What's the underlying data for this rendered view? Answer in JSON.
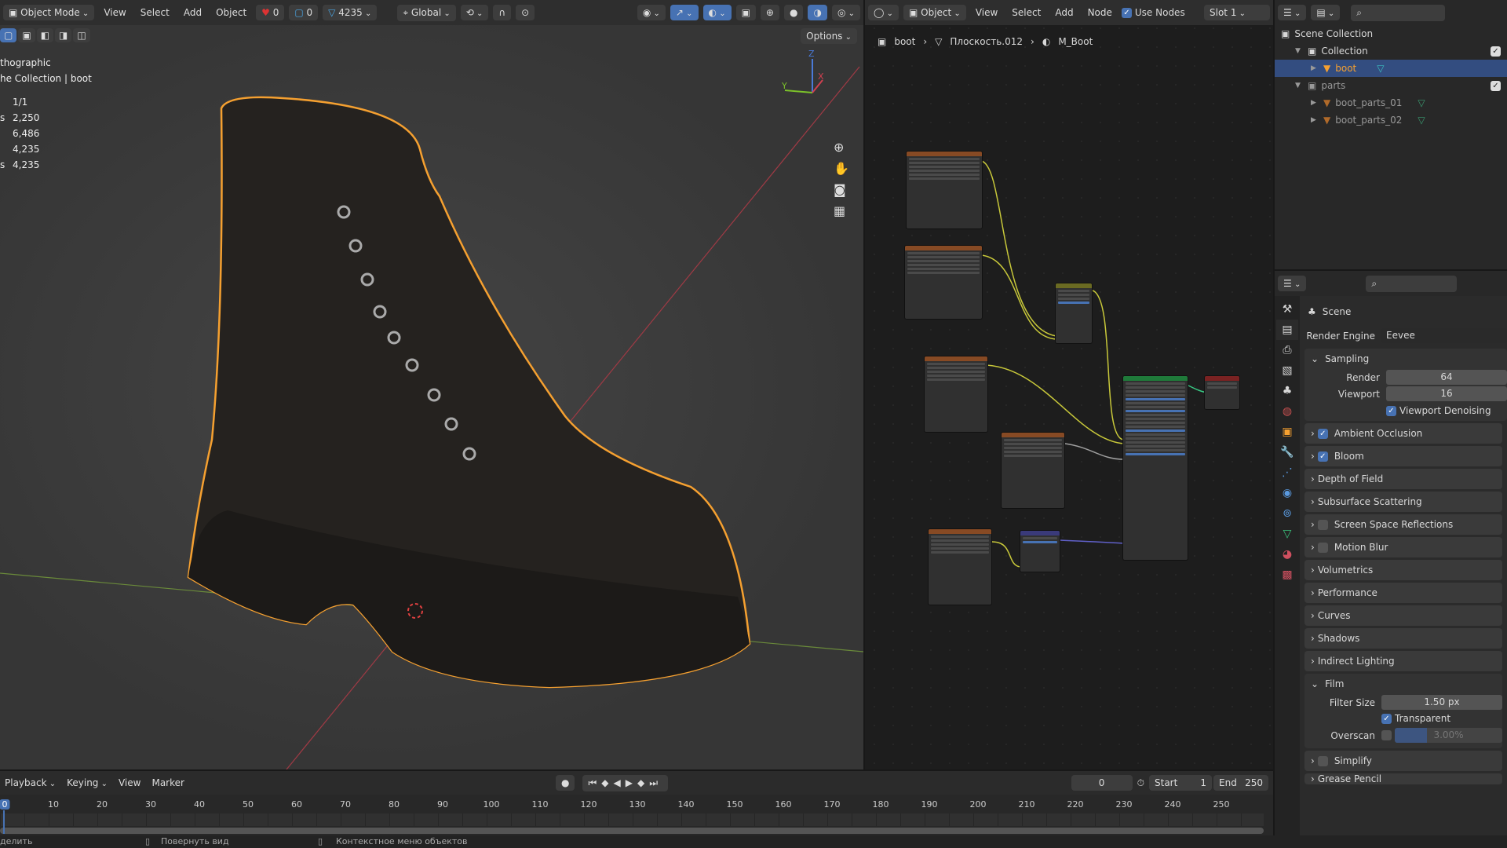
{
  "viewport": {
    "mode": "Object Mode",
    "menus": [
      "View",
      "Select",
      "Add",
      "Object"
    ],
    "overlay_counts": {
      "pose": "0",
      "edge": "0",
      "verts": "4235"
    },
    "transform": "Global",
    "options": "Options",
    "view_name": "thographic",
    "collection_path": "he Collection | boot",
    "stats": [
      {
        "label": "",
        "value": "1/1"
      },
      {
        "label": "s",
        "value": "2,250"
      },
      {
        "label": "",
        "value": "6,486"
      },
      {
        "label": "",
        "value": "4,235"
      },
      {
        "label": "s",
        "value": "4,235"
      }
    ],
    "gizmo": {
      "x": "X",
      "y": "Y",
      "z": "Z"
    }
  },
  "node_editor": {
    "type": "Object",
    "menus": [
      "View",
      "Select",
      "Add",
      "Node"
    ],
    "use_nodes": "Use Nodes",
    "slot": "Slot 1",
    "breadcrumb": [
      "boot",
      "Плоскость.012",
      "M_Boot"
    ]
  },
  "outliner": {
    "root": "Scene Collection",
    "items": [
      {
        "label": "Collection",
        "level": 1,
        "type": "collection"
      },
      {
        "label": "boot",
        "level": 2,
        "type": "mesh",
        "selected": true
      },
      {
        "label": "parts",
        "level": 1,
        "type": "collection"
      },
      {
        "label": "boot_parts_01",
        "level": 2,
        "type": "mesh"
      },
      {
        "label": "boot_parts_02",
        "level": 2,
        "type": "mesh"
      }
    ]
  },
  "properties": {
    "context": "Scene",
    "render_engine_label": "Render Engine",
    "render_engine": "Eevee",
    "sampling": {
      "title": "Sampling",
      "render_label": "Render",
      "render": "64",
      "viewport_label": "Viewport",
      "viewport": "16",
      "denoise": "Viewport Denoising"
    },
    "sections": [
      {
        "label": "Ambient Occlusion",
        "check": true
      },
      {
        "label": "Bloom",
        "check": true
      },
      {
        "label": "Depth of Field"
      },
      {
        "label": "Subsurface Scattering"
      },
      {
        "label": "Screen Space Reflections",
        "check": false
      },
      {
        "label": "Motion Blur",
        "check": false
      },
      {
        "label": "Volumetrics"
      },
      {
        "label": "Performance"
      },
      {
        "label": "Curves"
      },
      {
        "label": "Shadows"
      },
      {
        "label": "Indirect Lighting"
      }
    ],
    "film": {
      "title": "Film",
      "filter_label": "Filter Size",
      "filter": "1.50 px",
      "transparent": "Transparent",
      "overscan_label": "Overscan",
      "overscan": "3.00%"
    },
    "simplify": "Simplify",
    "grease_pencil": "Grease Pencil"
  },
  "timeline": {
    "menus": [
      "Playback",
      "Keying",
      "View",
      "Marker"
    ],
    "current_frame": "0",
    "start_label": "Start",
    "start": "1",
    "end_label": "End",
    "end": "250",
    "ticks": [
      "0",
      "10",
      "20",
      "30",
      "40",
      "50",
      "60",
      "70",
      "80",
      "90",
      "100",
      "110",
      "120",
      "130",
      "140",
      "150",
      "160",
      "170",
      "180",
      "190",
      "200",
      "210",
      "220",
      "230",
      "240",
      "250"
    ]
  },
  "status": [
    "делить",
    "Повернуть вид",
    "Контекстное меню объектов"
  ],
  "colors": {
    "accent": "#4772b3",
    "selection": "#f5a030",
    "header": "#303030"
  }
}
